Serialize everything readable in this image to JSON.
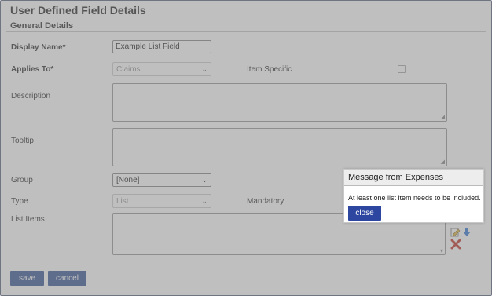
{
  "page": {
    "title": "User Defined Field Details",
    "section": "General Details"
  },
  "form": {
    "display_name": {
      "label": "Display Name*",
      "value": "Example List Field"
    },
    "applies_to": {
      "label": "Applies To*",
      "value": "Claims"
    },
    "item_specific": {
      "label": "Item Specific"
    },
    "description": {
      "label": "Description"
    },
    "tooltip": {
      "label": "Tooltip"
    },
    "group": {
      "label": "Group",
      "value": "[None]"
    },
    "type": {
      "label": "Type",
      "value": "List"
    },
    "mandatory": {
      "label": "Mandatory"
    },
    "list_items": {
      "label": "List Items"
    }
  },
  "footer": {
    "save_label": "save",
    "cancel_label": "cancel"
  },
  "dialog": {
    "title": "Message from Expenses",
    "message": "At least one list item needs to be included.",
    "close_label": "close"
  },
  "icons": {
    "edit": "edit-pencil-icon",
    "move_down": "arrow-down-icon",
    "delete": "delete-x-icon",
    "resize": "resize-grip-icon",
    "dropdown": "chevron-down-icon"
  },
  "colors": {
    "primary_button": "#3d5a99",
    "dialog_button": "#2d47a0",
    "overlay": "#808080",
    "delete_icon": "#c0392b",
    "arrow_icon": "#3a7bd5"
  }
}
